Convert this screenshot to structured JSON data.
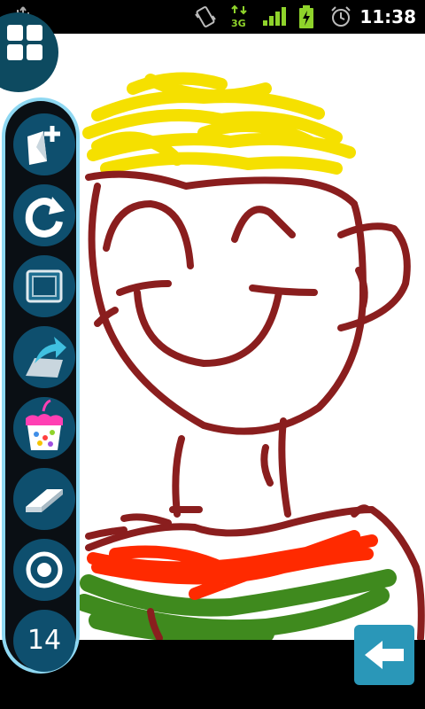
{
  "status_bar": {
    "time": "11:38",
    "network_type": "3G",
    "icons": [
      "usb-icon",
      "vibrate-icon",
      "network-3g-icon",
      "signal-icon",
      "battery-charging-icon",
      "alarm-icon"
    ]
  },
  "drawing": {
    "description_icon": "doodle-face-drawing",
    "stroke_colors": {
      "outline": "#8a1e1e",
      "hair": "#f5e000",
      "red_stripe": "#ff2a00",
      "green_stripe": "#3f8a1e"
    }
  },
  "menu": {
    "icon": "grid-icon"
  },
  "toolbar": {
    "tools": [
      {
        "name": "new-page",
        "icon": "new-page-icon"
      },
      {
        "name": "undo",
        "icon": "undo-icon"
      },
      {
        "name": "frame",
        "icon": "frame-icon"
      },
      {
        "name": "share",
        "icon": "share-icon"
      },
      {
        "name": "paint-bucket",
        "icon": "paint-bucket-icon"
      },
      {
        "name": "eraser",
        "icon": "eraser-icon"
      },
      {
        "name": "brush",
        "icon": "brush-icon"
      }
    ],
    "brush_size": "14"
  },
  "back": {
    "icon": "back-arrow-icon"
  },
  "colors": {
    "toolbar_bg": "#0a0f14",
    "toolbar_border": "#8fd8f2",
    "tool_bg": "#0e4f6e",
    "back_button": "#2a97b8"
  }
}
